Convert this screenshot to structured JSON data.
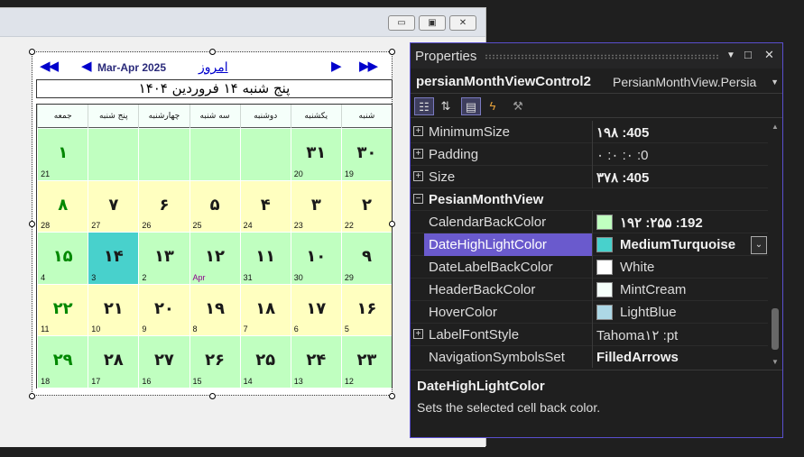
{
  "window": {
    "minimize_glyph": "▭",
    "maximize_glyph": "▣",
    "close_glyph": "✕"
  },
  "calendar": {
    "nav": {
      "prev_year": "◀◀",
      "prev_month": "◀",
      "range_label": "Mar-Apr 2025",
      "today_link": "امروز",
      "next_month": "▶",
      "next_year": "▶▶"
    },
    "date_label": "پنج شنبه  ۱۴  فروردین  ۱۴۰۴",
    "weekdays": [
      "شنبه",
      "یکشنبه",
      "دوشنبه",
      "سه شنبه",
      "چهارشنبه",
      "پنج شنبه",
      "جمعه"
    ],
    "weeks": [
      [
        {
          "num": "۳۰",
          "sub": "19",
          "bg": "green"
        },
        {
          "num": "۳۱",
          "sub": "20",
          "bg": "green"
        },
        {
          "num": "",
          "sub": "",
          "bg": "green"
        },
        {
          "num": "",
          "sub": "",
          "bg": "green"
        },
        {
          "num": "",
          "sub": "",
          "bg": "green"
        },
        {
          "num": "",
          "sub": "",
          "bg": "green"
        },
        {
          "num": "۱",
          "sub": "21",
          "bg": "green",
          "fri": true
        }
      ],
      [
        {
          "num": "۲",
          "sub": "22",
          "bg": "yellow"
        },
        {
          "num": "۳",
          "sub": "23",
          "bg": "yellow"
        },
        {
          "num": "۴",
          "sub": "24",
          "bg": "yellow"
        },
        {
          "num": "۵",
          "sub": "25",
          "bg": "yellow"
        },
        {
          "num": "۶",
          "sub": "26",
          "bg": "yellow"
        },
        {
          "num": "۷",
          "sub": "27",
          "bg": "yellow"
        },
        {
          "num": "۸",
          "sub": "28",
          "bg": "yellow",
          "fri": true
        }
      ],
      [
        {
          "num": "۹",
          "sub": "29",
          "bg": "green"
        },
        {
          "num": "۱۰",
          "sub": "30",
          "bg": "green"
        },
        {
          "num": "۱۱",
          "sub": "31",
          "bg": "green"
        },
        {
          "num": "۱۲",
          "sub": "Apr",
          "bg": "green",
          "month": true
        },
        {
          "num": "۱۳",
          "sub": "2",
          "bg": "green"
        },
        {
          "num": "۱۴",
          "sub": "3",
          "bg": "hl"
        },
        {
          "num": "۱۵",
          "sub": "4",
          "bg": "green",
          "fri": true
        }
      ],
      [
        {
          "num": "۱۶",
          "sub": "5",
          "bg": "yellow"
        },
        {
          "num": "۱۷",
          "sub": "6",
          "bg": "yellow"
        },
        {
          "num": "۱۸",
          "sub": "7",
          "bg": "yellow"
        },
        {
          "num": "۱۹",
          "sub": "8",
          "bg": "yellow"
        },
        {
          "num": "۲۰",
          "sub": "9",
          "bg": "yellow"
        },
        {
          "num": "۲۱",
          "sub": "10",
          "bg": "yellow"
        },
        {
          "num": "۲۲",
          "sub": "11",
          "bg": "yellow",
          "fri": true
        }
      ],
      [
        {
          "num": "۲۳",
          "sub": "12",
          "bg": "green"
        },
        {
          "num": "۲۴",
          "sub": "13",
          "bg": "green"
        },
        {
          "num": "۲۵",
          "sub": "14",
          "bg": "green"
        },
        {
          "num": "۲۶",
          "sub": "15",
          "bg": "green"
        },
        {
          "num": "۲۷",
          "sub": "16",
          "bg": "green"
        },
        {
          "num": "۲۸",
          "sub": "17",
          "bg": "green"
        },
        {
          "num": "۲۹",
          "sub": "18",
          "bg": "green",
          "fri": true
        }
      ]
    ],
    "colors": {
      "green": "#c0ffc0",
      "yellow": "#ffffc0",
      "highlight": "#48d1cc",
      "header": "#f5fffa",
      "friday": "#008800"
    }
  },
  "properties": {
    "title": "Properties",
    "object_name": "persianMonthViewControl2",
    "object_type": "PersianMonthView.Persia",
    "rows": [
      {
        "name": "MinimumSize",
        "value": "۱۹۸ :405",
        "expand": true,
        "bold": true
      },
      {
        "name": "Padding",
        "value": "۰ :۰ :۰ :0",
        "expand": true
      },
      {
        "name": "Size",
        "value": "۳۷۸ :405",
        "expand": true,
        "bold": true
      },
      {
        "name": "PesianMonthView",
        "value": "",
        "category": true
      },
      {
        "name": "CalendarBackColor",
        "value": "۱۹۲ :۲۵۵ :192",
        "swatch": "#c0ffc0",
        "bold": true
      },
      {
        "name": "DateHighLightColor",
        "value": "MediumTurquoise",
        "swatch": "#48d1cc",
        "bold": true,
        "selected": true
      },
      {
        "name": "DateLabelBackColor",
        "value": "White",
        "swatch": "#ffffff"
      },
      {
        "name": "HeaderBackColor",
        "value": "MintCream",
        "swatch": "#f5fffa"
      },
      {
        "name": "HoverColor",
        "value": "LightBlue",
        "swatch": "#add8e6"
      },
      {
        "name": "LabelFontStyle",
        "value": "Tahoma۱۲ :pt",
        "expand": true
      },
      {
        "name": "NavigationSymbolsSet",
        "value": "FilledArrows",
        "bold": true
      }
    ],
    "description": {
      "title": "DateHighLightColor",
      "text": "Sets the selected cell back color."
    },
    "accent": "#6a5acd"
  }
}
